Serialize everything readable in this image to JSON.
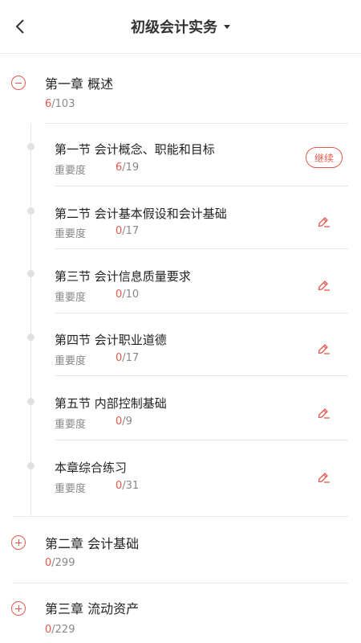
{
  "header": {
    "title": "初级会计实务"
  },
  "chapters": [
    {
      "title": "第一章 概述",
      "done": "6",
      "total": "/103",
      "sections": [
        {
          "title": "第一节 会计概念、职能和目标",
          "importance_label": "重要度",
          "done": "6",
          "total": "/19",
          "action": "继续"
        },
        {
          "title": "第二节 会计基本假设和会计基础",
          "importance_label": "重要度",
          "done": "0",
          "total": "/17"
        },
        {
          "title": "第三节 会计信息质量要求",
          "importance_label": "重要度",
          "done": "0",
          "total": "/10"
        },
        {
          "title": "第四节 会计职业道德",
          "importance_label": "重要度",
          "done": "0",
          "total": "/17"
        },
        {
          "title": "第五节 内部控制基础",
          "importance_label": "重要度",
          "done": "0",
          "total": "/9"
        },
        {
          "title": "本章综合练习",
          "importance_label": "重要度",
          "done": "0",
          "total": "/31"
        }
      ]
    },
    {
      "title": "第二章 会计基础",
      "done": "0",
      "total": "/299"
    },
    {
      "title": "第三章 流动资产",
      "done": "0",
      "total": "/229"
    }
  ],
  "icons": {
    "back": "chevron-left-icon",
    "dropdown": "caret-down-icon",
    "collapse": "minus-circle-icon",
    "expand": "plus-circle-icon",
    "practice": "pen-icon"
  },
  "colors": {
    "accent": "#e4584e",
    "muted": "#888888"
  }
}
